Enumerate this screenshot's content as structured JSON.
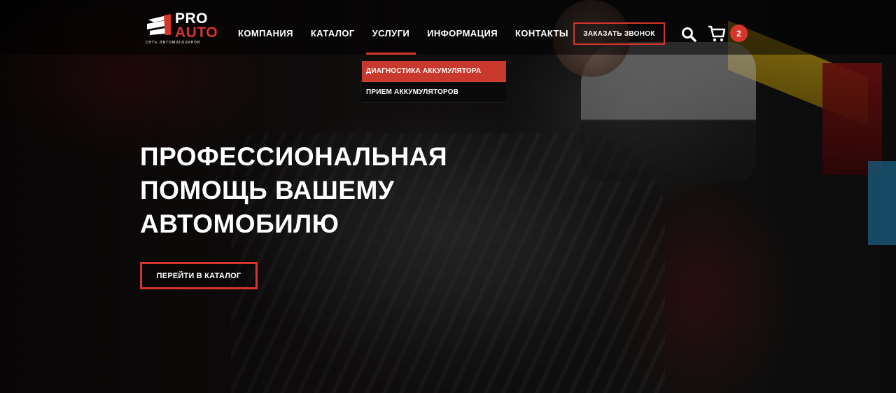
{
  "logo": {
    "line1": "PRO",
    "line2": "AUTO",
    "subtitle": "сеть автомагазинов"
  },
  "nav": {
    "items": [
      {
        "label": "КОМПАНИЯ"
      },
      {
        "label": "КАТАЛОГ"
      },
      {
        "label": "УСЛУГИ"
      },
      {
        "label": "ИНФОРМАЦИЯ"
      },
      {
        "label": "КОНТАКТЫ"
      }
    ],
    "active_item": "УСЛУГИ"
  },
  "header": {
    "call_button_label": "ЗАКАЗАТЬ ЗВОНОК",
    "cart_count": "2"
  },
  "dropdown": {
    "items": [
      {
        "label": "ДИАГНОСТИКА АККУМУЛЯТОРА",
        "highlighted": true
      },
      {
        "label": "ПРИЕМ АККУМУЛЯТОРОВ",
        "highlighted": false
      }
    ]
  },
  "hero": {
    "title_lines": [
      "ПРОФЕССИОНАЛЬНАЯ",
      "ПОМОЩЬ ВАШЕМУ",
      "АВТОМОБИЛЮ"
    ],
    "button_label": "ПЕРЕЙТИ В КАТАЛОГ"
  },
  "colors": {
    "accent": "#d5352a",
    "header_bg": "#000000",
    "text": "#ffffff"
  },
  "icons": [
    "search-icon",
    "cart-icon",
    "logo-icon"
  ]
}
